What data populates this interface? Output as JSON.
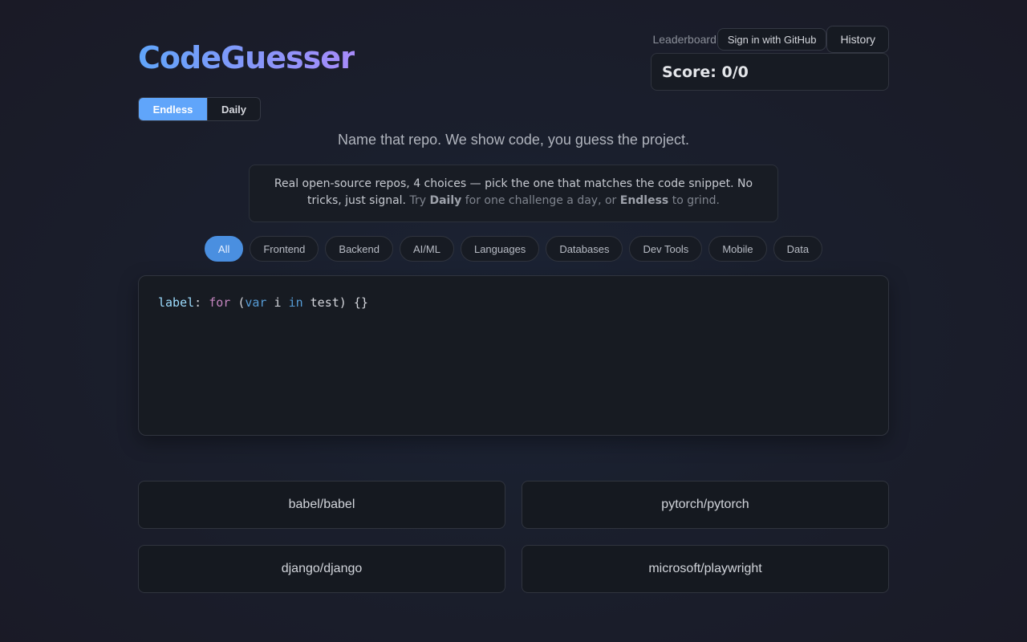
{
  "header": {
    "logo": "CodeGuesser",
    "leaderboard": "Leaderboard",
    "sign_in": "Sign in with GitHub",
    "history": "History",
    "score": "Score: 0/0"
  },
  "modes": {
    "endless": "Endless",
    "daily": "Daily",
    "selected": "Endless"
  },
  "tagline": "Name that repo. We show code, you guess the project.",
  "info": {
    "line1": "Real open-source repos, 4 choices — pick the one that matches the code snippet. No tricks, just signal.",
    "try": "Try",
    "daily": "Daily",
    "mid": "for one challenge a day, or",
    "endless": "Endless",
    "end": "to grind."
  },
  "filters": [
    "All",
    "Frontend",
    "Backend",
    "AI/ML",
    "Languages",
    "Databases",
    "Dev Tools",
    "Mobile",
    "Data"
  ],
  "active_filter": "All",
  "code": {
    "label": "label",
    "colon": ": ",
    "kw_for": "for",
    "open": " (",
    "kw_var": "var",
    "ident": " i ",
    "kw_in": "in",
    "rest": " test) {}"
  },
  "answers": [
    "babel/babel",
    "pytorch/pytorch",
    "django/django",
    "microsoft/playwright"
  ],
  "colors": {
    "accent": "#60a5fa",
    "accent2": "#a78bfa",
    "chip_active": "#4a8fe0"
  }
}
